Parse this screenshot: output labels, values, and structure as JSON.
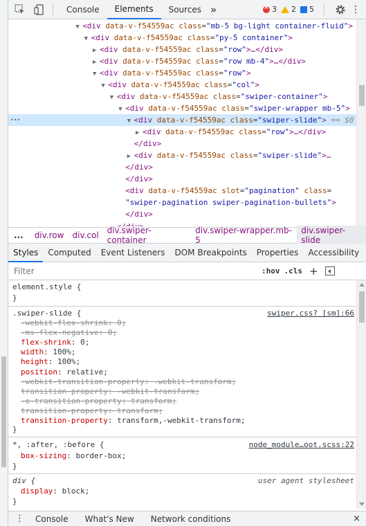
{
  "toolbar": {
    "tabs": [
      "Console",
      "Elements",
      "Sources"
    ],
    "more": "»",
    "errors": "3",
    "warnings": "2",
    "info": "5",
    "kebab": "⋮"
  },
  "dom": {
    "lines": [
      {
        "indent": 8,
        "arrow": "▼",
        "open": "<div ",
        "attrs": [
          [
            "data-v-f54559ac",
            ""
          ],
          [
            "class",
            "mb-5 bg-light container-fluid"
          ]
        ],
        "close": ">"
      },
      {
        "indent": 9,
        "arrow": "▼",
        "open": "<div ",
        "attrs": [
          [
            "data-v-f54559ac",
            ""
          ],
          [
            "class",
            "py-5 container"
          ]
        ],
        "close": ">"
      },
      {
        "indent": 10,
        "arrow": "▶",
        "open": "<div ",
        "attrs": [
          [
            "data-v-f54559ac",
            ""
          ],
          [
            "class",
            "row"
          ]
        ],
        "close": ">…</div>"
      },
      {
        "indent": 10,
        "arrow": "▶",
        "open": "<div ",
        "attrs": [
          [
            "data-v-f54559ac",
            ""
          ],
          [
            "class",
            "row mb-4"
          ]
        ],
        "close": ">…</div>"
      },
      {
        "indent": 10,
        "arrow": "▼",
        "open": "<div ",
        "attrs": [
          [
            "data-v-f54559ac",
            ""
          ],
          [
            "class",
            "row"
          ]
        ],
        "close": ">"
      },
      {
        "indent": 11,
        "arrow": "▼",
        "open": "<div ",
        "attrs": [
          [
            "data-v-f54559ac",
            ""
          ],
          [
            "class",
            "col"
          ]
        ],
        "close": ">"
      },
      {
        "indent": 12,
        "arrow": "▼",
        "open": "<div ",
        "attrs": [
          [
            "data-v-f54559ac",
            ""
          ],
          [
            "class",
            "swiper-container"
          ]
        ],
        "close": ">"
      },
      {
        "indent": 13,
        "arrow": "▼",
        "open": "<div ",
        "attrs": [
          [
            "data-v-f54559ac",
            ""
          ],
          [
            "class",
            "swiper-wrapper mb-5"
          ]
        ],
        "close": ">"
      },
      {
        "indent": 14,
        "arrow": "▼",
        "open": "<div ",
        "attrs": [
          [
            "data-v-f54559ac",
            ""
          ],
          [
            "class",
            "swiper-slide"
          ]
        ],
        "close": ">",
        "selected": true,
        "suffix": " == $0"
      },
      {
        "indent": 15,
        "arrow": "▶",
        "open": "<div ",
        "attrs": [
          [
            "data-v-f54559ac",
            ""
          ],
          [
            "class",
            "row"
          ]
        ],
        "close": ">…</div>"
      },
      {
        "indent": 14,
        "arrow": "",
        "open": "</div>",
        "attrs": [],
        "close": ""
      },
      {
        "indent": 14,
        "arrow": "▶",
        "open": "<div ",
        "attrs": [
          [
            "data-v-f54559ac",
            ""
          ],
          [
            "class",
            "swiper-slide"
          ]
        ],
        "close": ">…"
      },
      {
        "indent": 13,
        "arrow": "",
        "open": "</div>",
        "attrs": [],
        "close": ""
      },
      {
        "indent": 13,
        "arrow": "",
        "open": "</div>",
        "attrs": [],
        "close": ""
      },
      {
        "indent": 13,
        "arrow": "",
        "open": "<div ",
        "attrs": [
          [
            "data-v-f54559ac",
            ""
          ],
          [
            "slot",
            "pagination"
          ],
          [
            "class",
            ""
          ]
        ],
        "close": "",
        "tail_attr": true
      },
      {
        "indent": 13,
        "arrow": "",
        "open": "",
        "attrs": [],
        "close": ">",
        "continued_value": "swiper-pagination swiper-pagination-bullets"
      },
      {
        "indent": 13,
        "arrow": "",
        "open": "</div>",
        "attrs": [],
        "close": ""
      },
      {
        "indent": 12,
        "arrow": "",
        "open": "</div>",
        "attrs": [],
        "close": ""
      }
    ]
  },
  "breadcrumbs": {
    "dots": "...",
    "items": [
      "div.row",
      "div.col",
      "div.swiper-container",
      "div.swiper-wrapper.mb-5",
      "div.swiper-slide"
    ]
  },
  "subtabs": [
    "Styles",
    "Computed",
    "Event Listeners",
    "DOM Breakpoints",
    "Properties",
    "Accessibility"
  ],
  "filter": {
    "placeholder": "Filter",
    "hov": ":hov",
    "cls": ".cls",
    "plus": "+"
  },
  "styles": {
    "element_style": "element.style {",
    "close": "}",
    "swiper_selector": ".swiper-slide {",
    "swiper_source": "swiper.css? [sm]:66",
    "swiper_props": [
      {
        "name": "-webkit-flex-shrink",
        "value": "0",
        "struck": true
      },
      {
        "name": "-ms-flex-negative",
        "value": "0",
        "struck": true
      },
      {
        "name": "flex-shrink",
        "value": "0",
        "struck": false
      },
      {
        "name": "width",
        "value": "100%",
        "struck": false
      },
      {
        "name": "height",
        "value": "100%",
        "struck": false
      },
      {
        "name": "position",
        "value": "relative",
        "struck": false
      },
      {
        "name": "-webkit-transition-property",
        "value": "-webkit-transform",
        "struck": true
      },
      {
        "name": "transition-property",
        "value": "-webkit-transform",
        "struck": true
      },
      {
        "name": "-o-transition-property",
        "value": "transform",
        "struck": true
      },
      {
        "name": "transition-property",
        "value": "transform",
        "struck": true
      },
      {
        "name": "transition-property",
        "value": "transform,-webkit-transform",
        "struck": false
      }
    ],
    "universal_selector": "*, :after, :before {",
    "universal_source": "node_module…oot.scss:22",
    "universal_props": [
      {
        "name": "box-sizing",
        "value": "border-box",
        "struck": false
      }
    ],
    "div_selector": "div {",
    "div_source": "user agent stylesheet",
    "div_props": [
      {
        "name": "display",
        "value": "block",
        "struck": false
      }
    ]
  },
  "drawer": {
    "kebab": "⋮",
    "tabs": [
      "Console",
      "What's New",
      "Network conditions"
    ],
    "close": "×"
  }
}
